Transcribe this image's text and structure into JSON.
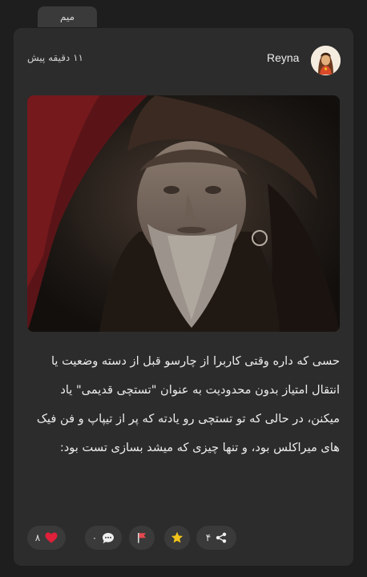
{
  "tab": {
    "label": "میم"
  },
  "post": {
    "author": "Reyna",
    "time": "۱۱ دقیقه پیش",
    "text": "حسی که داره وقتی کاربرا از چارسو قبل از دسته وضعیت یا انتقال امتیاز بدون محدودیت به عنوان \"تستچی قدیمی\" یاد میکنن، در حالی که تو تستچی رو یادته که پر از تیپاپ و فن فیک های میراکلس بود، و تنها چیزی که میشد بسازی تست بود:"
  },
  "actions": {
    "likes": "۸",
    "comments": "۰",
    "shares": "۴"
  },
  "icons": {
    "like": "heart-icon",
    "comment": "comment-bubble-icon",
    "report": "flag-icon",
    "favorite": "star-icon",
    "share": "share-icon"
  },
  "colors": {
    "background": "#1e1e1e",
    "card": "#2c2c2c",
    "pill": "#3a3a3a",
    "heart": "#e0203a",
    "flag": "#e5484d",
    "star": "#f2c31b"
  }
}
